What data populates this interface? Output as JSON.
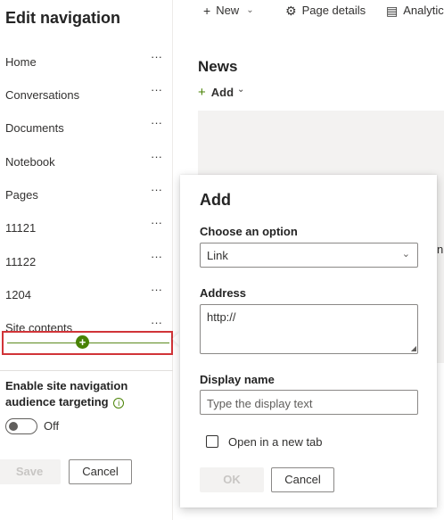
{
  "left_panel": {
    "title": "Edit navigation",
    "nav_items": [
      {
        "label": "Home",
        "more": "···"
      },
      {
        "label": "Conversations",
        "more": "···"
      },
      {
        "label": "Documents",
        "more": "···"
      },
      {
        "label": "Notebook",
        "more": "···"
      },
      {
        "label": "Pages",
        "more": "···"
      },
      {
        "label": "11121",
        "more": "···"
      },
      {
        "label": "11122",
        "more": "···"
      },
      {
        "label": "1204",
        "more": "···"
      },
      {
        "label": "Site contents",
        "more": "···"
      }
    ],
    "insert_plus": "+",
    "audience_targeting_label": "Enable site navigation audience targeting",
    "info_glyph": "i",
    "toggle_state": "Off",
    "save_label": "Save",
    "cancel_label": "Cancel"
  },
  "command_bar": {
    "new_label": "New",
    "page_details_label": "Page details",
    "analytics_label": "Analytic"
  },
  "main": {
    "news_title": "News",
    "add_label": "Add",
    "stray_text": "n"
  },
  "callout": {
    "title": "Add",
    "choose_label": "Choose an option",
    "choose_value": "Link",
    "address_label": "Address",
    "address_value": "http://",
    "display_name_label": "Display name",
    "display_name_placeholder": "Type the display text",
    "new_tab_label": "Open in a new tab",
    "ok_label": "OK",
    "cancel_label": "Cancel"
  },
  "colors": {
    "accent_green": "#498205",
    "highlight_red": "#d13438"
  }
}
